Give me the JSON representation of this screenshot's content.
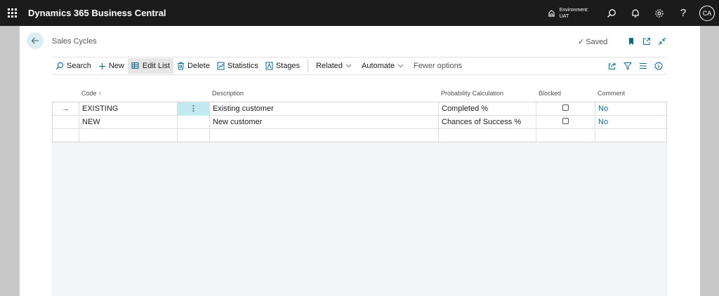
{
  "topbar": {
    "app_name": "Dynamics 365 Business Central",
    "environment_label": "Environment:",
    "environment_value": "UAT",
    "avatar_initials": "CA",
    "help_glyph": "?"
  },
  "page": {
    "title": "Sales Cycles",
    "saved_label": "Saved"
  },
  "actions": {
    "search": "Search",
    "new": "New",
    "edit_list": "Edit List",
    "delete": "Delete",
    "statistics": "Statistics",
    "stages": "Stages",
    "related": "Related",
    "automate": "Automate",
    "fewer_options": "Fewer options"
  },
  "table": {
    "columns": {
      "code": "Code",
      "code_sort": "↑",
      "description": "Description",
      "probability": "Probability Calculation",
      "blocked": "Blocked",
      "comment": "Comment"
    },
    "rows": [
      {
        "code": "EXISTING",
        "description": "Existing customer",
        "probability": "Completed %",
        "blocked": false,
        "comment": "No"
      },
      {
        "code": "NEW",
        "description": "New customer",
        "probability": "Chances of Success %",
        "blocked": false,
        "comment": "No"
      }
    ],
    "row_marker": "→",
    "kebab": "⋮"
  },
  "colors": {
    "topbar_bg": "#1b1b1b",
    "accent": "#0b6a8a",
    "selected_cell": "#c2eaf0"
  }
}
